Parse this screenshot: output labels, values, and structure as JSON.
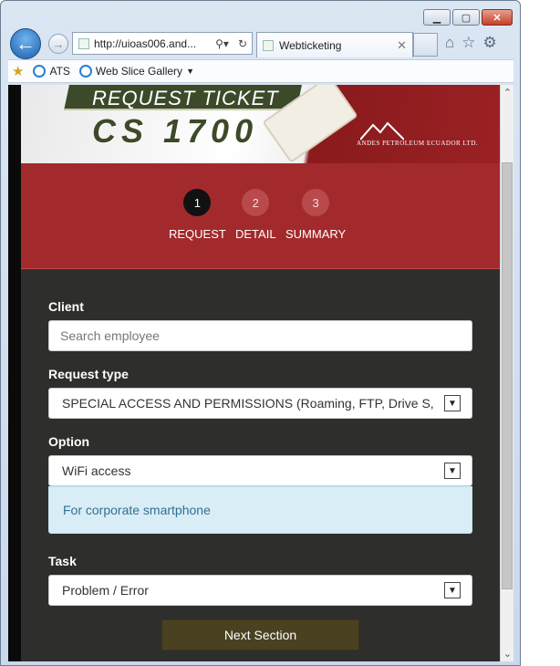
{
  "browser": {
    "address_url": "http://uioas006.and...",
    "tab_title": "Webticketing",
    "favorites": [
      {
        "label": "ATS",
        "icon": "ie-page-icon"
      },
      {
        "label": "Web Slice Gallery",
        "icon": "ie-page-icon"
      }
    ],
    "window_controls": {
      "minimize": "▁",
      "maximize": "▢",
      "close": "✕"
    }
  },
  "banner": {
    "tag_text": "REQUEST TICKET",
    "big_text": "CS 1700",
    "company": "ANDES PETROLEUM ECUADOR LTD."
  },
  "steps": [
    {
      "number": "1",
      "label": "REQUEST",
      "active": true
    },
    {
      "number": "2",
      "label": "DETAIL",
      "active": false
    },
    {
      "number": "3",
      "label": "SUMMARY",
      "active": false
    }
  ],
  "form": {
    "client_label": "Client",
    "client_placeholder": "Search employee",
    "request_type_label": "Request type",
    "request_type_value": "SPECIAL ACCESS AND PERMISSIONS (Roaming, FTP, Drive S,",
    "option_label": "Option",
    "option_value": "WiFi access",
    "option_info": "For corporate smartphone",
    "task_label": "Task",
    "task_value": "Problem / Error",
    "next_label": "Next Section"
  },
  "colors": {
    "banner_red": "#a32a2c",
    "page_bg": "#2e2e2c",
    "active_step": "#111111",
    "info_bg": "#d9edf7",
    "info_text": "#31708f",
    "next_button": "#4a4120"
  }
}
